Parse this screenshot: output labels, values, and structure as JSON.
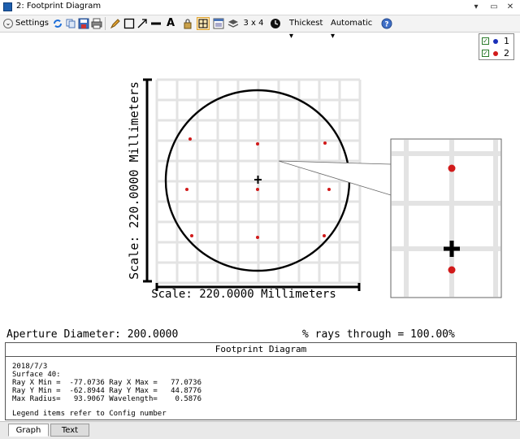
{
  "window": {
    "title": "2: Footprint Diagram"
  },
  "toolbar": {
    "settings_label": "Settings",
    "layout_label": "3 x 4",
    "line_label": "Thickest",
    "scale_label": "Automatic"
  },
  "legend": {
    "items": [
      {
        "label": "1",
        "color": "#1a2fb8",
        "checked": true
      },
      {
        "label": "2",
        "color": "#d11a1a",
        "checked": true
      }
    ]
  },
  "plot": {
    "y_scale_label": "Scale: 220.0000 Millimeters",
    "x_scale_label": "Scale: 220.0000 Millimeters",
    "aperture_text": "Aperture Diameter: 200.0000",
    "rays_text": "% rays through = 100.00%"
  },
  "panel": {
    "title": "Footprint Diagram",
    "date": "2018/7/3",
    "surface": "Surface 40:",
    "row1": "Ray X Min =  -77.0736 Ray X Max =   77.0736",
    "row2": "Ray Y Min =  -62.8944 Ray Y Max =   44.8776",
    "row3": "Max Radius=   93.9067 Wavelength=    0.5876",
    "note": "Legend items refer to Config number"
  },
  "tabs": [
    {
      "label": "Graph",
      "active": true
    },
    {
      "label": "Text",
      "active": false
    }
  ],
  "colors": {
    "ray_color": "#d11a1a",
    "grid_color": "#e3e3e3"
  }
}
